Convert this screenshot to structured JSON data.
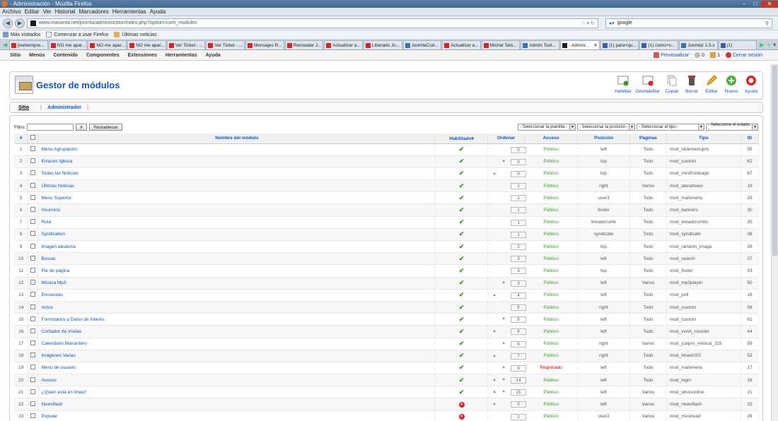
{
  "window": {
    "title": "- Administración - Mozilla Firefox"
  },
  "menubar": [
    "Archivo",
    "Editar",
    "Ver",
    "Historial",
    "Marcadores",
    "Herramientas",
    "Ayuda"
  ],
  "navbar": {
    "url": "www.mananta.net/joomla/administrator/index.php?option=com_modules",
    "search_value": "google"
  },
  "bookmarks": [
    "Más visitados",
    "Comenzar a usar Firefox",
    "Últimas noticias"
  ],
  "tabs": [
    {
      "label": "[webempre...",
      "icon": "y"
    },
    {
      "label": "NO me apar...",
      "icon": "y"
    },
    {
      "label": "NO me apar...",
      "icon": "y"
    },
    {
      "label": "NO me apar...",
      "icon": "y"
    },
    {
      "label": "Ver Ticket - ...",
      "icon": "y"
    },
    {
      "label": "Ver Ticket - ...",
      "icon": "y"
    },
    {
      "label": "Mensajes R...",
      "icon": "y"
    },
    {
      "label": "Reinstalar J...",
      "icon": "y"
    },
    {
      "label": "Actualizar a...",
      "icon": "y"
    },
    {
      "label": "Liberado Jo...",
      "icon": "y"
    },
    {
      "label": "JoomlaCod...",
      "icon": "j"
    },
    {
      "label": "Actualizar a...",
      "icon": "y"
    },
    {
      "label": "Michel Teló...",
      "icon": "y"
    },
    {
      "label": "Admin Tool...",
      "icon": "j"
    },
    {
      "label": "- Admini...",
      "icon": "x",
      "active": true
    },
    {
      "label": "(1) para+qu...",
      "icon": "f"
    },
    {
      "label": "(1) como+v...",
      "icon": "f"
    },
    {
      "label": "Joomla! 1.5.x",
      "icon": "j"
    },
    {
      "label": "(1)",
      "icon": "f"
    }
  ],
  "joomla_menu": [
    "Sitio",
    "Menús",
    "Contenido",
    "Componentes",
    "Extensiones",
    "Herramientas",
    "Ayuda"
  ],
  "header_right": {
    "preview": "Previsualizar",
    "messages": "0",
    "users": "1",
    "logout": "Cerrar sesión"
  },
  "page_title": "Gestor de módulos",
  "toolbar": [
    "Habilitar",
    "Deshabilitar",
    "Copiar",
    "Borrar",
    "Editar",
    "Nuevo",
    "Ayuda"
  ],
  "subnav": {
    "site": "Sitio",
    "admin": "Administrador"
  },
  "filter": {
    "label": "Filtro:",
    "go": "Ir",
    "reset": "Restablecer",
    "template": "- Seleccionar la plantilla -",
    "position": "- Seleccionar la posición -",
    "type": "- Seleccionar el tipo -",
    "state": "- Seleccione el estado -"
  },
  "columns": {
    "num": "#",
    "name": "Nombre del módulo",
    "enabled": "Habilitado",
    "order": "Ordenar",
    "access": "Acceso",
    "position": "Posición",
    "pages": "Páginas",
    "type": "Tipo",
    "id": "ID"
  },
  "rows": [
    {
      "n": "1",
      "name": "Menú Agrupación",
      "enabled": true,
      "up": false,
      "down": false,
      "order": "0",
      "access": "Público",
      "position": "left",
      "pages": "Todo",
      "type": "mod_slidemenupro",
      "id": "55"
    },
    {
      "n": "2",
      "name": "Enlaces Iglesia",
      "enabled": true,
      "up": false,
      "down": true,
      "order": "0",
      "access": "Público",
      "position": "top",
      "pages": "Todo",
      "type": "mod_custom",
      "id": "62"
    },
    {
      "n": "3",
      "name": "Todas las Noticias",
      "enabled": true,
      "up": true,
      "down": false,
      "order": "0",
      "access": "Público",
      "position": "top",
      "pages": "Todo",
      "type": "mod_minifrontpage",
      "id": "67"
    },
    {
      "n": "4",
      "name": "Últimas Noticias",
      "enabled": true,
      "up": false,
      "down": false,
      "order": "1",
      "access": "Público",
      "position": "right",
      "pages": "Varios",
      "type": "mod_latestnews",
      "id": "19"
    },
    {
      "n": "5",
      "name": "Menu Superior",
      "enabled": true,
      "up": false,
      "down": false,
      "order": "1",
      "access": "Público",
      "position": "user3",
      "pages": "Todo",
      "type": "mod_mainmenu",
      "id": "29"
    },
    {
      "n": "6",
      "name": "Anuncios",
      "enabled": true,
      "up": false,
      "down": false,
      "order": "1",
      "access": "Público",
      "position": "footer",
      "pages": "Todo",
      "type": "mod_banners",
      "id": "30"
    },
    {
      "n": "7",
      "name": "Ruta",
      "enabled": true,
      "up": false,
      "down": false,
      "order": "1",
      "access": "Público",
      "position": "breadcrumb",
      "pages": "Todo",
      "type": "mod_breadcrumbs",
      "id": "35"
    },
    {
      "n": "8",
      "name": "Syndication",
      "enabled": true,
      "up": false,
      "down": false,
      "order": "1",
      "access": "Público",
      "position": "syndicate",
      "pages": "Todo",
      "type": "mod_syndicate",
      "id": "36"
    },
    {
      "n": "9",
      "name": "Imagen aleatoria",
      "enabled": true,
      "up": false,
      "down": false,
      "order": "2",
      "access": "Público",
      "position": "top",
      "pages": "Todo",
      "type": "mod_random_image",
      "id": "28"
    },
    {
      "n": "10",
      "name": "Buscar",
      "enabled": true,
      "up": false,
      "down": false,
      "order": "3",
      "access": "Público",
      "position": "left",
      "pages": "Todo",
      "type": "mod_search",
      "id": "27"
    },
    {
      "n": "11",
      "name": "Pie de página",
      "enabled": true,
      "up": false,
      "down": false,
      "order": "3",
      "access": "Público",
      "position": "top",
      "pages": "Todo",
      "type": "mod_footer",
      "id": "33"
    },
    {
      "n": "12",
      "name": "Música Mp3",
      "enabled": true,
      "up": false,
      "down": true,
      "order": "3",
      "access": "Público",
      "position": "left",
      "pages": "Varios",
      "type": "mod_mp3player",
      "id": "50"
    },
    {
      "n": "13",
      "name": "Encuestas",
      "enabled": true,
      "up": true,
      "down": false,
      "order": "4",
      "access": "Público",
      "position": "left",
      "pages": "Todo",
      "type": "mod_poll",
      "id": "16"
    },
    {
      "n": "14",
      "name": "Actos",
      "enabled": true,
      "up": false,
      "down": false,
      "order": "5",
      "access": "Público",
      "position": "right",
      "pages": "Todo",
      "type": "mod_custom",
      "id": "56"
    },
    {
      "n": "15",
      "name": "Formularios y Datos de Interés.",
      "enabled": true,
      "up": false,
      "down": true,
      "order": "5",
      "access": "Público",
      "position": "left",
      "pages": "Todo",
      "type": "mod_custom",
      "id": "61"
    },
    {
      "n": "16",
      "name": "Contador de Visitas",
      "enabled": true,
      "up": true,
      "down": false,
      "order": "6",
      "access": "Público",
      "position": "left",
      "pages": "Todo",
      "type": "mod_vvisit_counter",
      "id": "44"
    },
    {
      "n": "17",
      "name": "Calendario Manantero",
      "enabled": true,
      "up": false,
      "down": true,
      "order": "6",
      "access": "Público",
      "position": "right",
      "pages": "Varios",
      "type": "mod_jcalpro_minical_J15",
      "id": "59"
    },
    {
      "n": "18",
      "name": "Imágenes Varias",
      "enabled": true,
      "up": true,
      "down": false,
      "order": "7",
      "access": "Público",
      "position": "right",
      "pages": "Todo",
      "type": "mod_briaskISS",
      "id": "52"
    },
    {
      "n": "19",
      "name": "Menú de usuario",
      "enabled": true,
      "up": false,
      "down": true,
      "order": "9",
      "access": "Registrado",
      "position": "left",
      "pages": "Todo",
      "type": "mod_mainmenu",
      "id": "17"
    },
    {
      "n": "20",
      "name": "Acceso",
      "enabled": true,
      "up": true,
      "down": true,
      "order": "14",
      "access": "Público",
      "position": "left",
      "pages": "Todo",
      "type": "mod_login",
      "id": "18"
    },
    {
      "n": "21",
      "name": "¿Quién está en línea?",
      "enabled": true,
      "up": true,
      "down": true,
      "order": "21",
      "access": "Público",
      "position": "left",
      "pages": "Varios",
      "type": "mod_whosonline",
      "id": "21"
    },
    {
      "n": "22",
      "name": "Newsflash",
      "enabled": false,
      "up": true,
      "down": false,
      "order": "0",
      "access": "Público",
      "position": "left",
      "pages": "Varios",
      "type": "mod_newsflash",
      "id": "25"
    },
    {
      "n": "23",
      "name": "Popular",
      "enabled": false,
      "up": false,
      "down": false,
      "order": "1",
      "access": "Público",
      "position": "user2",
      "pages": "Varios",
      "type": "mod_mostread",
      "id": "26"
    }
  ]
}
